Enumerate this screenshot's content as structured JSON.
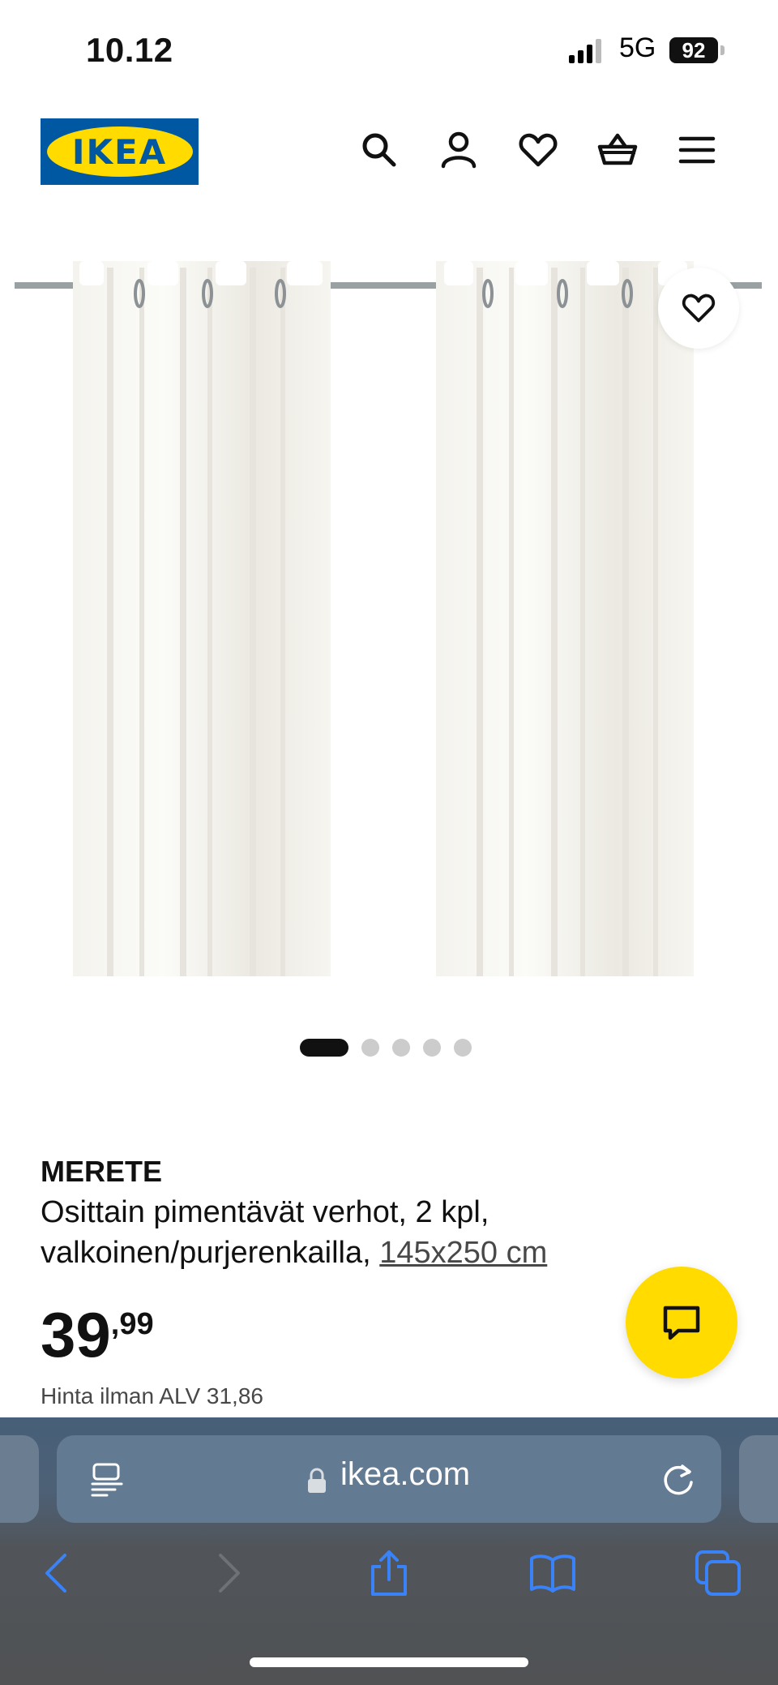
{
  "status_bar": {
    "time": "10.12",
    "network": "5G",
    "battery": "92"
  },
  "header": {
    "logo_text": "IKEA",
    "icons": [
      "search-icon",
      "account-icon",
      "heart-icon",
      "basket-icon",
      "menu-icon"
    ]
  },
  "carousel": {
    "total": 5,
    "active_index": 0
  },
  "product": {
    "name": "MERETE",
    "description": "Osittain pimentävät verhot, 2 kpl, valkoinen/purjerenkailla,",
    "size": "145x250 cm",
    "price_integer": "39",
    "price_decimal": ",99",
    "vat_text": "Hinta ilman ALV 31,86"
  },
  "browser": {
    "url": "ikea.com"
  },
  "colors": {
    "ikea_blue": "#0058a3",
    "ikea_yellow": "#ffdb00",
    "safari_blue": "#3a82f7"
  }
}
